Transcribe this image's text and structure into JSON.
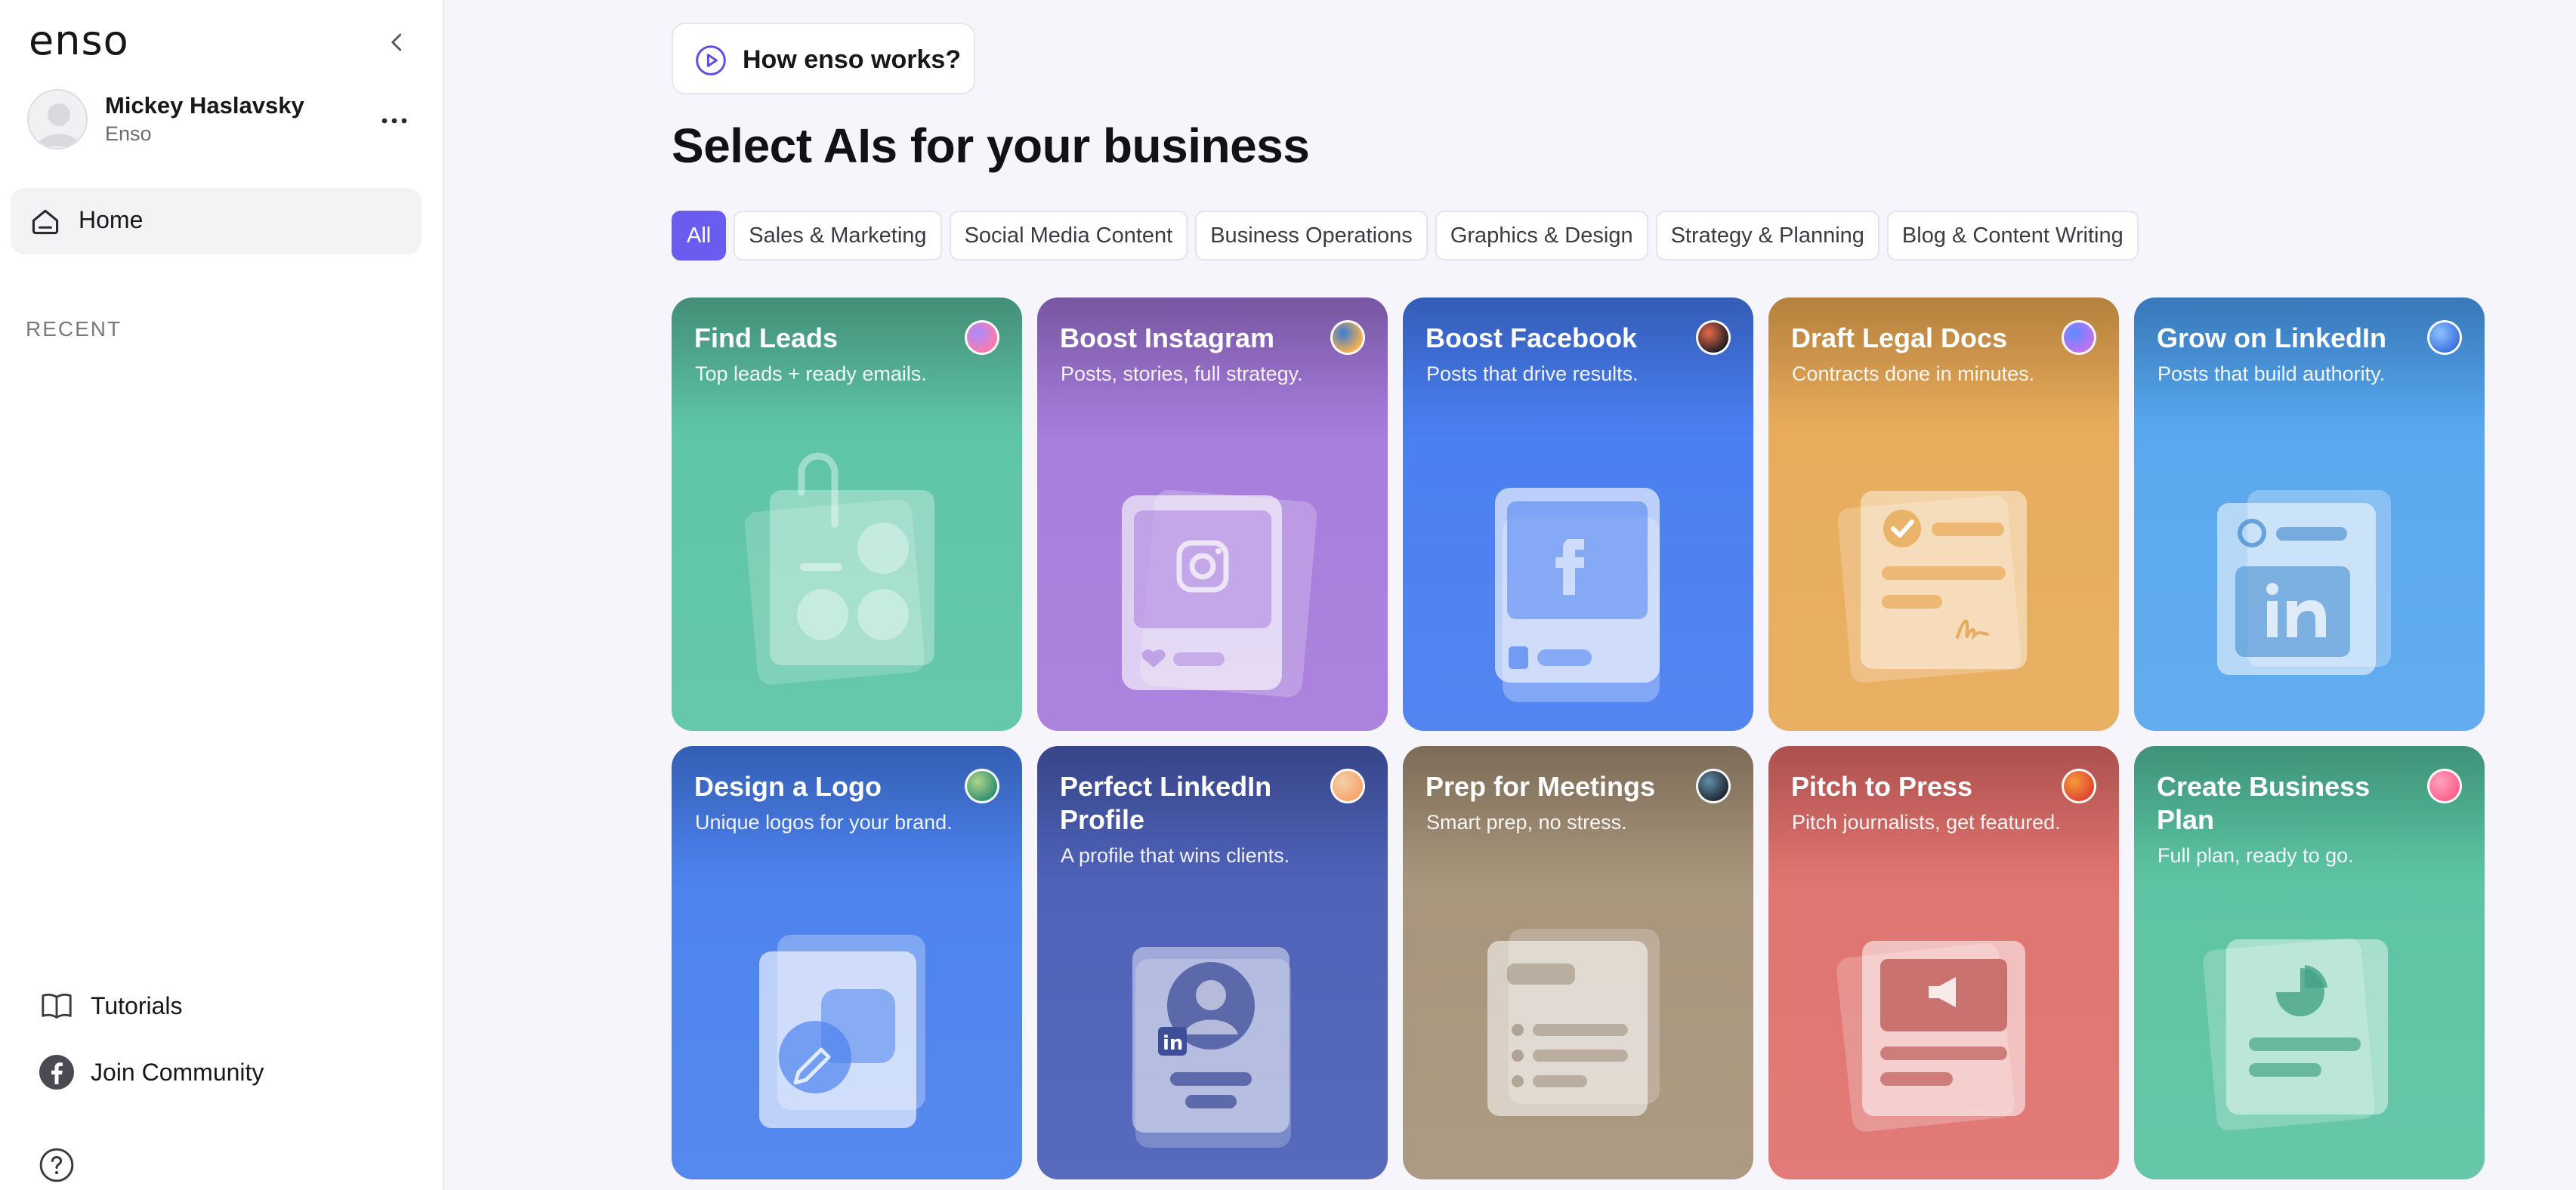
{
  "app": {
    "logo": "enso"
  },
  "user": {
    "name": "Mickey Haslavsky",
    "org": "Enso"
  },
  "nav": {
    "home": "Home",
    "recent_label": "RECENT"
  },
  "bottom_links": {
    "tutorials": "Tutorials",
    "community": "Join Community"
  },
  "how_button": {
    "label": "How enso works?"
  },
  "page": {
    "title": "Select AIs for your business"
  },
  "filters": [
    {
      "label": "All",
      "active": true
    },
    {
      "label": "Sales & Marketing"
    },
    {
      "label": "Social Media Content"
    },
    {
      "label": "Business Operations"
    },
    {
      "label": "Graphics & Design"
    },
    {
      "label": "Strategy & Planning"
    },
    {
      "label": "Blog & Content Writing"
    }
  ],
  "cards": [
    {
      "title": "Find Leads",
      "subtitle": "Top leads + ready emails.",
      "color": "#5ec5a6",
      "top_color": "#4a9e84",
      "icon": "lead-contacts-icon",
      "badge": [
        "#ff7aa8",
        "#a98cff"
      ]
    },
    {
      "title": "Boost Instagram",
      "subtitle": "Posts, stories, full strategy.",
      "color": "#a77ddc",
      "top_color": "#8560b4",
      "icon": "instagram-icon",
      "badge": [
        "#ffb347",
        "#3a7bd5"
      ]
    },
    {
      "title": "Boost Facebook",
      "subtitle": "Posts that drive results.",
      "color": "#4a7ff0",
      "top_color": "#3a67cc",
      "icon": "facebook-icon",
      "badge": [
        "#1d1d24",
        "#e86a4a"
      ]
    },
    {
      "title": "Draft Legal Docs",
      "subtitle": "Contracts done in minutes.",
      "color": "#e8ac5c",
      "top_color": "#c98f45",
      "icon": "legal-document-icon",
      "badge": [
        "#c86ff0",
        "#5a8cff"
      ]
    },
    {
      "title": "Grow on LinkedIn",
      "subtitle": "Posts that build authority.",
      "color": "#5aa8ee",
      "top_color": "#3d86cd",
      "icon": "linkedin-icon",
      "badge": [
        "#3b6fe0",
        "#8fc3ff"
      ]
    },
    {
      "title": "Design a Logo",
      "subtitle": "Unique logos for your brand.",
      "color": "#4d83ee",
      "top_color": "#3a69c8",
      "icon": "logo-design-icon",
      "badge": [
        "#2f8f6f",
        "#b0d58a"
      ]
    },
    {
      "title": "Perfect LinkedIn Profile",
      "subtitle": "A profile that wins clients.",
      "color": "#4f62b8",
      "top_color": "#3d4d98",
      "icon": "linkedin-profile-icon",
      "badge": [
        "#f9a36b",
        "#f2d0a9"
      ]
    },
    {
      "title": "Prep for Meetings",
      "subtitle": "Smart prep, no stress.",
      "color": "#a8957c",
      "top_color": "#8a7861",
      "icon": "meeting-notes-icon",
      "badge": [
        "#1f2430",
        "#5f8fa8"
      ]
    },
    {
      "title": "Pitch to Press",
      "subtitle": "Pitch journalists, get featured.",
      "color": "#e07470",
      "top_color": "#bf5a57",
      "icon": "press-megaphone-icon",
      "badge": [
        "#e0442f",
        "#f59a3b"
      ]
    },
    {
      "title": "Create Business Plan",
      "subtitle": "Full plan, ready to go.",
      "color": "#5ec4a4",
      "top_color": "#45a386",
      "icon": "business-plan-icon",
      "badge": [
        "#ff5f8a",
        "#ffa2c0"
      ]
    }
  ]
}
